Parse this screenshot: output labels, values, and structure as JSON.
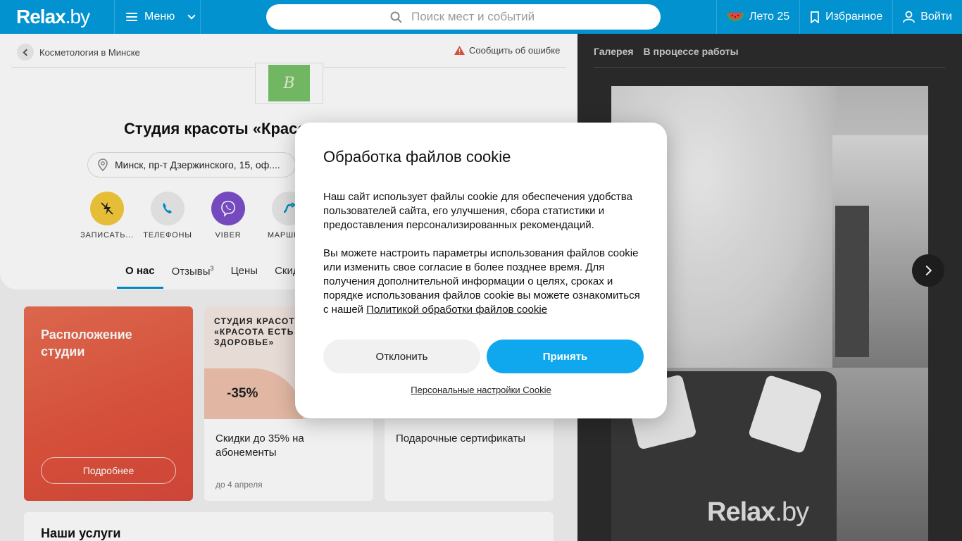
{
  "header": {
    "logo": "Relax",
    "logo_suffix": ".by",
    "menu_label": "Меню",
    "search_placeholder": "Поиск мест и событий",
    "summer_label": "Лето 25",
    "favorites_label": "Избранное",
    "login_label": "Войти"
  },
  "breadcrumb": {
    "label": "Косметология в Минске",
    "report_label": "Сообщить об ошибке"
  },
  "place": {
    "logo_letter": "B",
    "title": "Студия красоты «Красота Есть Здоровье»",
    "address": "Минск, пр-т Дзержинского, 15, оф...."
  },
  "actions": [
    {
      "label": "ЗАПИСАТЬ...",
      "icon": "booking-icon",
      "color": "#f5c93a"
    },
    {
      "label": "ТЕЛЕФОНЫ",
      "icon": "phone-icon",
      "color": "#e8e8e8"
    },
    {
      "label": "VIBER",
      "icon": "viber-icon",
      "color": "#7d4fcb"
    },
    {
      "label": "МАРШРУТ",
      "icon": "route-icon",
      "color": "#e8e8e8"
    }
  ],
  "tabs": [
    {
      "label": "О нас",
      "active": true
    },
    {
      "label": "Отзывы",
      "count": "3"
    },
    {
      "label": "Цены"
    },
    {
      "label": "Скидки"
    }
  ],
  "promos": {
    "location": {
      "title": "Расположение студии",
      "button": "Подробнее"
    },
    "discount": {
      "caption": "СТУДИЯ КРАСОТЫ «КРАСОТА ЕСТЬ ЗДОРОВЬЕ»",
      "badge": "-35%",
      "text": "Скидки до 35% на абонементы",
      "date": "до 4 апреля"
    },
    "gift": {
      "text": "Подарочные сертификаты"
    }
  },
  "services_title": "Наши услуги",
  "gallery": {
    "tabs": [
      "Галерея",
      "В процессе работы"
    ],
    "watermark": "Relax",
    "watermark_suffix": ".by"
  },
  "cookie_modal": {
    "title": "Обработка файлов cookie",
    "paragraph1": "Наш сайт использует файлы cookie для обеспечения удобства пользователей сайта, его улучшения, сбора статистики и предоставления персонализированных рекомендаций.",
    "paragraph2": "Вы можете настроить параметры использования файлов cookie или изменить свое согласие в более позднее время. Для получения дополнительной информации о целях, сроках и порядке использования файлов cookie вы можете ознакомиться с нашей ",
    "policy_link": "Политикой обработки файлов cookie",
    "decline": "Отклонить",
    "accept": "Принять",
    "personal_settings": "Персональные настройки Cookie"
  },
  "colors": {
    "brand": "#0292cf",
    "accent": "#0fa8ef",
    "promo_red": "#e2533d"
  }
}
